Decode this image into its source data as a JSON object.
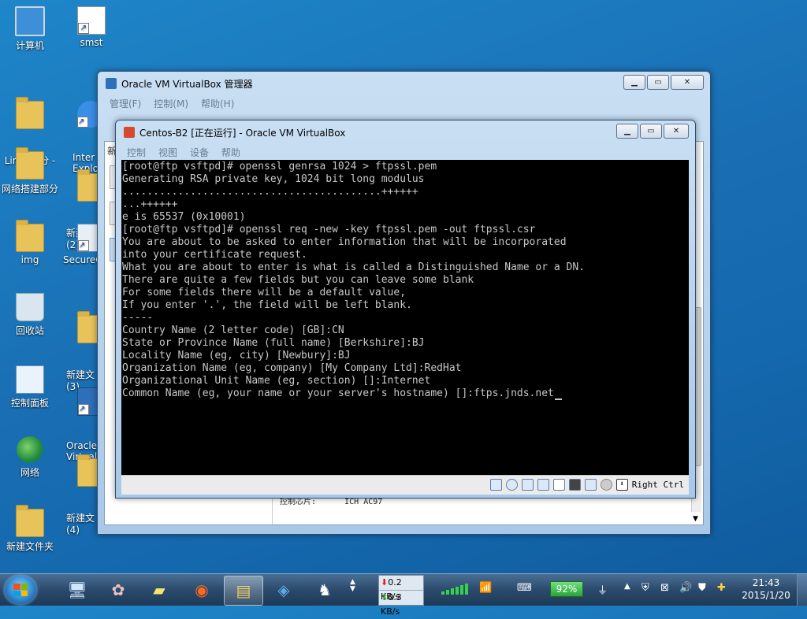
{
  "desktop": {
    "icons": [
      {
        "label": "计算机",
        "icon": "computer-icon"
      },
      {
        "label": "smst",
        "icon": "file-shortcut-icon"
      },
      {
        "label": "Linux部分 -\n副本",
        "icon": "folder-icon"
      },
      {
        "label": "Inter\nExplo",
        "icon": "internet-explorer-icon"
      },
      {
        "label": "网络搭建部分",
        "icon": "folder-icon"
      },
      {
        "label": "新建文\n(2)",
        "icon": "folder-icon"
      },
      {
        "label": "img",
        "icon": "folder-icon"
      },
      {
        "label": "SecureC",
        "icon": "securecrt-icon"
      },
      {
        "label": "回收站",
        "icon": "recycle-bin-icon"
      },
      {
        "label": "新建文\n(3)",
        "icon": "folder-icon"
      },
      {
        "label": "控制面板",
        "icon": "control-panel-icon"
      },
      {
        "label": "Oracle\nVirtual",
        "icon": "virtualbox-icon"
      },
      {
        "label": "网络",
        "icon": "network-icon"
      },
      {
        "label": "新建文\n(4)",
        "icon": "folder-icon"
      },
      {
        "label": "新建文件夹",
        "icon": "folder-icon"
      }
    ]
  },
  "manager_window": {
    "title": "Oracle VM VirtualBox 管理器",
    "menu": [
      "管理(F)",
      "控制(M)",
      "帮助(H)"
    ],
    "partial_tab": "新",
    "bottom_text": "控制芯片:      ICH AC97"
  },
  "vm_window": {
    "title": "Centos-B2 [正在运行] - Oracle VM VirtualBox",
    "menu": [
      "控制",
      "视图",
      "设备",
      "帮助"
    ],
    "terminal_text": "[root@ftp vsftpd]# openssl genrsa 1024 > ftpssl.pem\nGenerating RSA private key, 1024 bit long modulus\n..........................................++++++\n...++++++\ne is 65537 (0x10001)\n[root@ftp vsftpd]# openssl req -new -key ftpssl.pem -out ftpssl.csr\nYou are about to be asked to enter information that will be incorporated\ninto your certificate request.\nWhat you are about to enter is what is called a Distinguished Name or a DN.\nThere are quite a few fields but you can leave some blank\nFor some fields there will be a default value,\nIf you enter '.', the field will be left blank.\n-----\nCountry Name (2 letter code) [GB]:CN\nState or Province Name (full name) [Berkshire]:BJ\nLocality Name (eg, city) [Newbury]:BJ\nOrganization Name (eg, company) [My Company Ltd]:RedHat\nOrganizational Unit Name (eg, section) []:Internet\nCommon Name (eg, your name or your server's hostname) []:ftps.jnds.net",
    "host_key": "Right Ctrl"
  },
  "taskbar": {
    "net_down": "0.2 KB/s",
    "net_up": "0.3 KB/s",
    "battery": "92%",
    "time": "21:43",
    "date": "2015/1/20"
  }
}
